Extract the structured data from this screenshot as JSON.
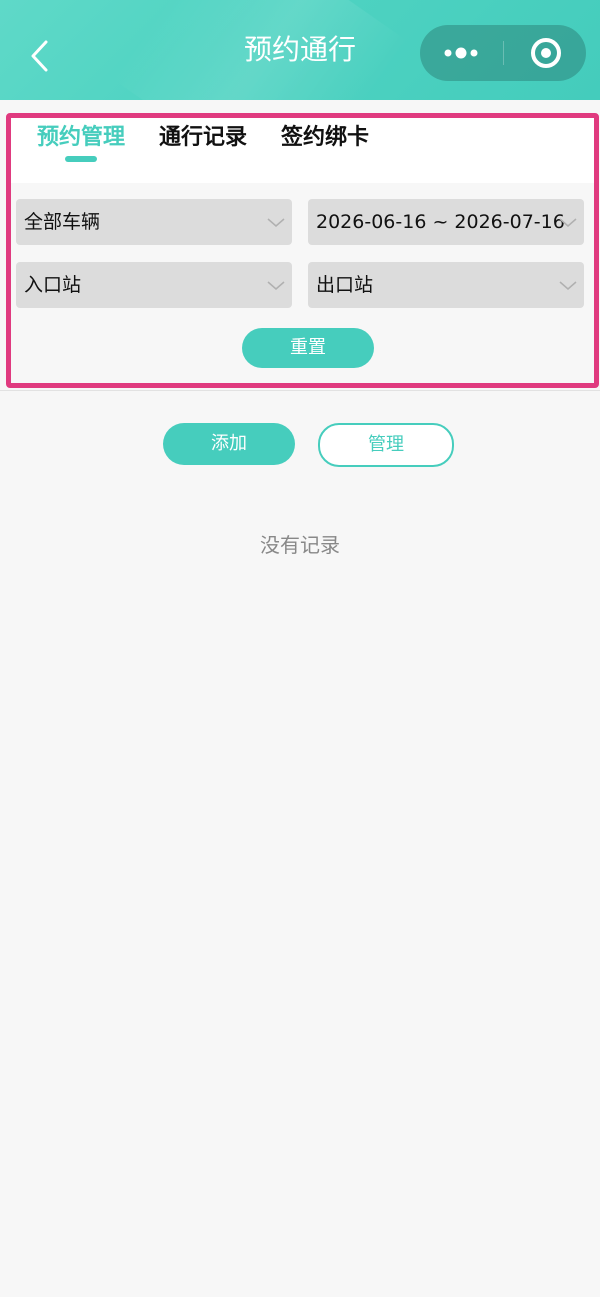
{
  "header": {
    "title": "预约通行",
    "back_icon": "chevron-left-icon",
    "more_icon": "more-dots-icon",
    "close_icon": "target-circle-icon",
    "gradient_colors": [
      "#5fd9c8",
      "#44ccbc"
    ]
  },
  "tabs": [
    {
      "label": "预约管理",
      "active": true
    },
    {
      "label": "通行记录",
      "active": false
    },
    {
      "label": "签约绑卡",
      "active": false
    }
  ],
  "filters": {
    "vehicle": "全部车辆",
    "date_range": "2026-06-16 ~ 2026-07-16",
    "entry_station": "入口站",
    "exit_station": "出口站",
    "dropdown_icon": "chevron-down-icon",
    "reset_label": "重置"
  },
  "actions": {
    "add_label": "添加",
    "manage_label": "管理"
  },
  "empty_text": "没有记录",
  "colors": {
    "accent": "#46cdbd",
    "highlight_border": "#e03a7f",
    "background": "#f7f7f7",
    "select_bg": "#dcdcdc"
  }
}
